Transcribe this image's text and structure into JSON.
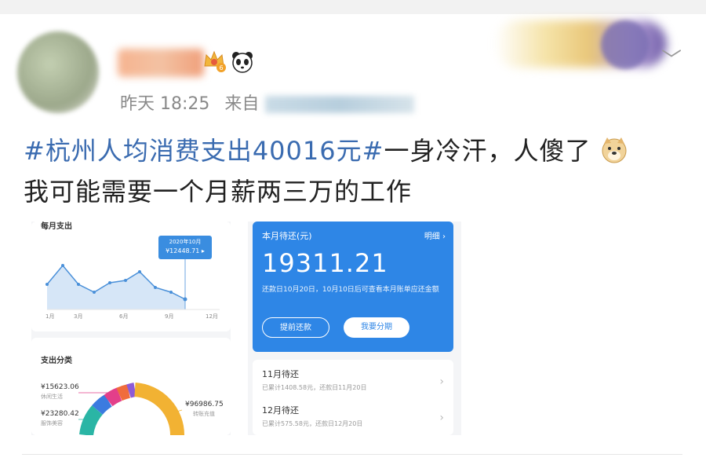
{
  "post": {
    "time": "昨天 18:25",
    "source_prefix": "来自",
    "hashtag": "#杭州人均消费支出40016元#",
    "text_line1": "一身冷汗，人傻了",
    "text_line2": "我可能需要一个月薪两三万的工作",
    "emoji": "doge",
    "badges": [
      "crown-level-6-badge",
      "panda-icon"
    ]
  },
  "left_screenshot": {
    "card1_title": "每月支出",
    "tooltip_month": "2020年10月",
    "tooltip_value": "¥12448.71",
    "x_labels": [
      "1月",
      "3月",
      "6月",
      "9月",
      "12月"
    ],
    "card2_title": "支出分类",
    "categories": [
      {
        "amount": "¥15623.06",
        "name": "休闲生活"
      },
      {
        "amount": "¥23280.42",
        "name": "服饰美容"
      },
      {
        "amount": "¥96986.75",
        "name": "转账充值"
      }
    ]
  },
  "right_screenshot": {
    "title": "本月待还(元)",
    "detail_link": "明细 ›",
    "amount": "19311.21",
    "note": "还款日10月20日，10月10日后可查看本月账单应还金额",
    "btn_prepay": "提前还款",
    "btn_install": "我要分期",
    "bills": [
      {
        "title": "11月待还",
        "sub": "已累计1408.58元，还款日11月20日"
      },
      {
        "title": "12月待还",
        "sub": "已累计575.58元，还款日12月20日"
      }
    ]
  },
  "colors": {
    "hashtag": "#3a6bb0",
    "alipay_blue": "#2e86e6"
  }
}
